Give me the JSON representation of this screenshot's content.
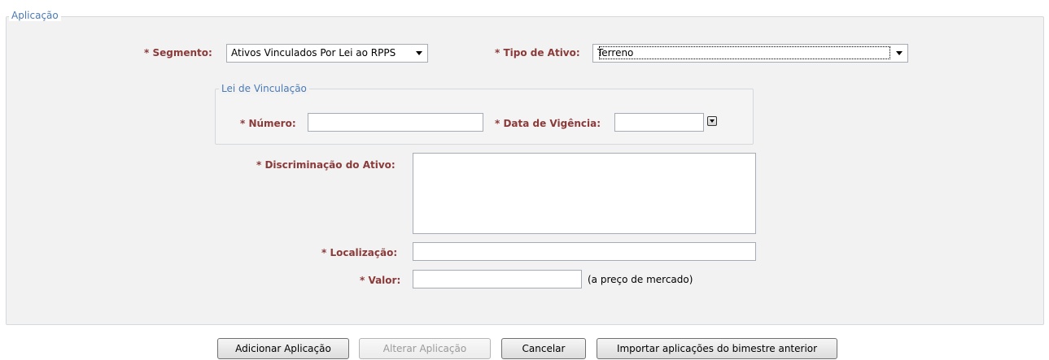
{
  "main_section": {
    "legend": "Aplicação"
  },
  "segmento": {
    "label": "* Segmento:",
    "selected": "Ativos Vinculados Por Lei ao RPPS"
  },
  "tipo_ativo": {
    "label": "* Tipo de Ativo:",
    "selected": "Terreno"
  },
  "lei_section": {
    "legend": "Lei de Vinculação",
    "numero_label": "* Número:",
    "numero_value": "",
    "data_label": "* Data de Vigência:",
    "data_value": ""
  },
  "discriminacao": {
    "label": "* Discriminação do Ativo:",
    "value": ""
  },
  "localizacao": {
    "label": "* Localização:",
    "value": ""
  },
  "valor": {
    "label": "* Valor:",
    "value": "",
    "hint": "(a preço de mercado)"
  },
  "buttons": {
    "add": "Adicionar Aplicação",
    "alter": "Alterar Aplicação",
    "cancel": "Cancelar",
    "import": "Importar aplicações do bimestre anterior"
  }
}
